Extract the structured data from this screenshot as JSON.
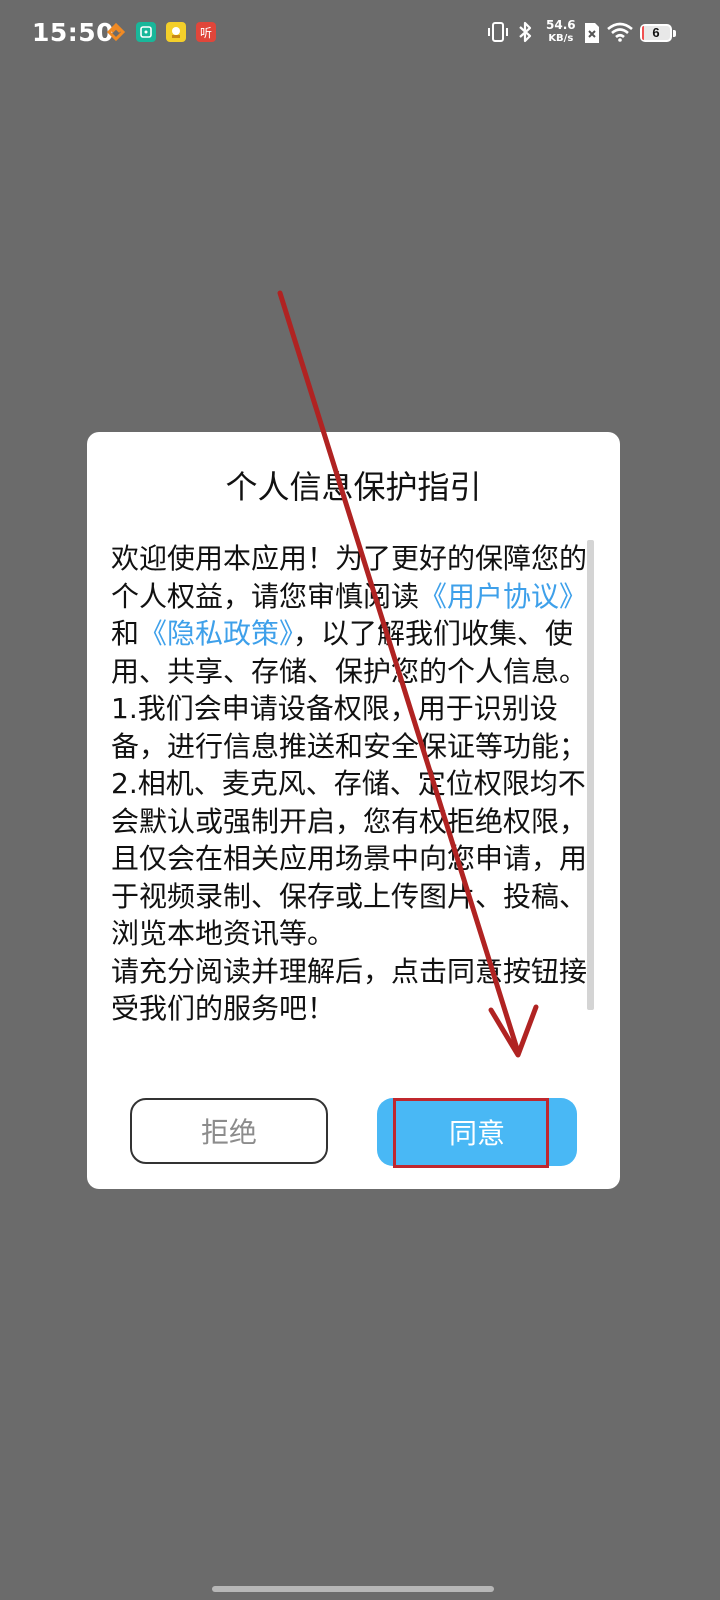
{
  "status_bar": {
    "time": "15:50",
    "net_speed_value": "54.6",
    "net_speed_unit": "KB/s",
    "battery_level": "6",
    "battery_fraction": 0.06
  },
  "notification_icons": [
    "taobao-icon",
    "mi-home-icon",
    "app-icon",
    "listen-icon"
  ],
  "notification_icon_labels": {
    "listen": "听"
  },
  "dialog": {
    "title": "个人信息保护指引",
    "body_intro": "欢迎使用本应用！为了更好的保障您的个人权益，请您审慎阅读",
    "user_agreement_link": "《用户协议》",
    "conjunction": "和",
    "privacy_policy_link": "《隐私政策》",
    "body_after_links": "，以了解我们收集、使用、共享、存储、保护您的个人信息。",
    "item_1": "1.我们会申请设备权限，用于识别设备，进行信息推送和安全保证等功能；",
    "item_2": "2.相机、麦克风、存储、定位权限均不会默认或强制开启，您有权拒绝权限，且仅会在相关应用场景中向您申请，用于视频录制、保存或上传图片、投稿、浏览本地资讯等。",
    "closing": "请充分阅读并理解后，点击同意按钮接受我们的服务吧！",
    "reject_label": "拒绝",
    "agree_label": "同意"
  },
  "colors": {
    "backdrop": "#6b6b6b",
    "link": "#3ea0ea",
    "agree_button": "#49b8f5",
    "annotation": "#c0272d"
  }
}
